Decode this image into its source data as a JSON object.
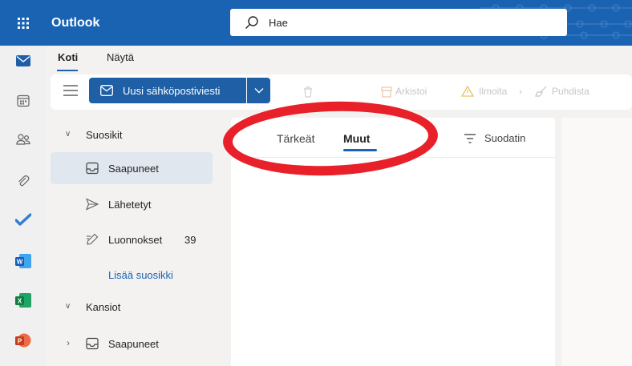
{
  "topbar": {
    "app_title": "Outlook",
    "search_placeholder": "Hae"
  },
  "rail": {
    "items": [
      {
        "name": "mail-icon"
      },
      {
        "name": "calendar-icon"
      },
      {
        "name": "people-icon"
      },
      {
        "name": "attach-icon"
      },
      {
        "name": "todo-icon"
      },
      {
        "name": "word-icon",
        "label": "W"
      },
      {
        "name": "excel-icon",
        "label": "X"
      },
      {
        "name": "powerpoint-icon",
        "label": "P"
      }
    ]
  },
  "ribbon": {
    "tabs": [
      {
        "label": "Koti",
        "selected": true
      },
      {
        "label": "Näytä",
        "selected": false
      }
    ]
  },
  "command_bar": {
    "new_mail_label": "Uusi sähköpostiviesti",
    "archive_label": "Arkistoi",
    "report_label": "Ilmoita",
    "sweep_label": "Puhdista"
  },
  "folder_pane": {
    "favorites_header": "Suosikit",
    "favorites": [
      {
        "label": "Saapuneet",
        "icon": "inbox-icon",
        "count": "",
        "active": true
      },
      {
        "label": "Lähetetyt",
        "icon": "send-icon",
        "count": "",
        "active": false
      },
      {
        "label": "Luonnokset",
        "icon": "drafts-icon",
        "count": "39",
        "active": false
      }
    ],
    "add_favorite_label": "Lisää suosikki",
    "folders_header": "Kansiot",
    "folders": [
      {
        "label": "Saapuneet",
        "icon": "inbox-icon"
      }
    ]
  },
  "message_list": {
    "pivots": [
      {
        "label": "Tärkeät",
        "selected": false
      },
      {
        "label": "Muut",
        "selected": true
      }
    ],
    "filter_label": "Suodatin"
  },
  "colors": {
    "brand": "#1a63b3",
    "highlight": "#e8202a"
  }
}
